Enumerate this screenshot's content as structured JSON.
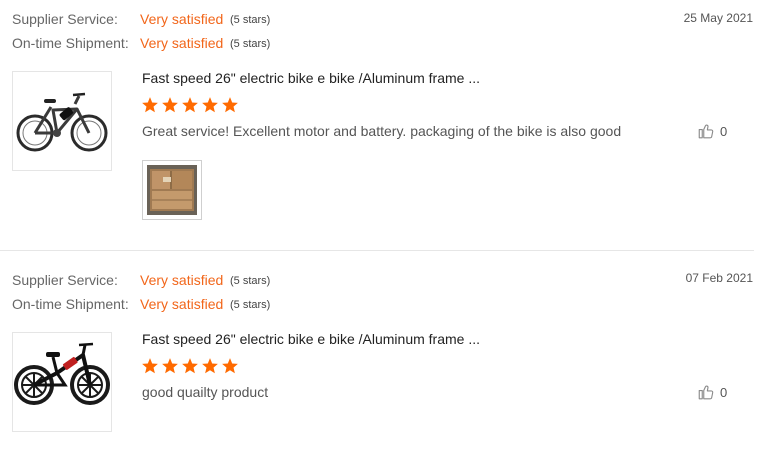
{
  "labels": {
    "supplier_service": "Supplier Service:",
    "on_time_shipment": "On-time Shipment:"
  },
  "colors": {
    "accent": "#f2661a",
    "star": "#ff6a00"
  },
  "reviews": [
    {
      "date": "25 May 2021",
      "supplier_service": {
        "value": "Very satisfied",
        "stars": "(5 stars)"
      },
      "on_time_shipment": {
        "value": "Very satisfied",
        "stars": "(5 stars)"
      },
      "product_image_icon": "ebike-hardtail-icon",
      "product_title": "Fast speed 26\" electric bike e bike /Aluminum frame ...",
      "rating": 5,
      "text": "Great service! Excellent motor and battery. packaging of the bike is also good",
      "likes": "0",
      "photos": [
        "cardboard-boxes-photo"
      ]
    },
    {
      "date": "07 Feb 2021",
      "supplier_service": {
        "value": "Very satisfied",
        "stars": "(5 stars)"
      },
      "on_time_shipment": {
        "value": "Very satisfied",
        "stars": "(5 stars)"
      },
      "product_image_icon": "ebike-folding-icon",
      "product_title": "Fast speed 26\" electric bike e bike /Aluminum frame ...",
      "rating": 5,
      "text": "good quailty product",
      "likes": "0",
      "photos": []
    }
  ]
}
